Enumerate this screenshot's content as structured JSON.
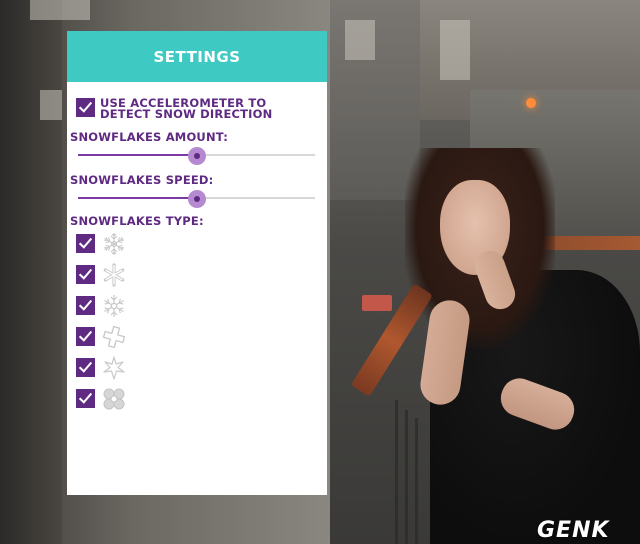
{
  "settings": {
    "title": "SETTINGS",
    "accelerometer": {
      "line1": "USE ACCELEROMETER TO",
      "line2": "DETECT SNOW DIRECTION",
      "checked": true
    },
    "amount": {
      "label": "SNOWFLAKES AMOUNT:",
      "value_fraction": 0.5
    },
    "speed": {
      "label": "SNOWFLAKES SPEED:",
      "value_fraction": 0.5
    },
    "type": {
      "label": "SNOWFLAKES TYPE:",
      "items": [
        {
          "icon": "snowflake-ornate-icon",
          "checked": true
        },
        {
          "icon": "snowflake-asterisk-icon",
          "checked": true
        },
        {
          "icon": "snowflake-crystal-icon",
          "checked": true
        },
        {
          "icon": "snowflake-cross-icon",
          "checked": true
        },
        {
          "icon": "snowflake-star-icon",
          "checked": true
        },
        {
          "icon": "snowflake-clover-icon",
          "checked": true
        }
      ]
    }
  },
  "colors": {
    "header": "#3fc9c3",
    "accent": "#5e2a82",
    "thumb": "#b58ad1"
  },
  "watermark": "GENK"
}
